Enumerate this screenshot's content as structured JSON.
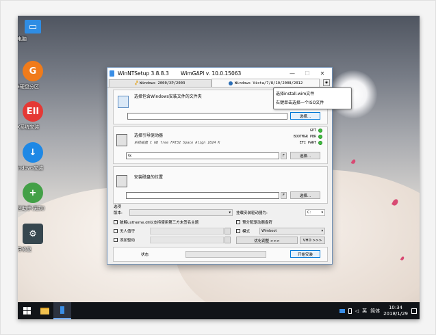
{
  "desktop": {
    "icons": [
      {
        "label": "此电脑",
        "icon": "computer-icon",
        "color": "#2f8de4"
      },
      {
        "label": "DG硬盘分区",
        "icon": "dg-icon",
        "color": "#f07b1a"
      },
      {
        "label": "EIX系统安装",
        "icon": "eix-icon",
        "color": "#e53935"
      },
      {
        "label": "Windows安装",
        "icon": "download-icon",
        "color": "#1e88e5"
      },
      {
        "label": "分区助手(无损)",
        "icon": "partition-icon",
        "color": "#43a047"
      },
      {
        "label": "引导修复",
        "icon": "gear-icon",
        "color": "#37474f"
      }
    ]
  },
  "window": {
    "title": "WinNTSetup 3.8.8.3",
    "title_api": "WimGAPI v. 10.0.15063",
    "tabs": [
      {
        "label": "Windows 2000/XP/2003"
      },
      {
        "label": "Windows Vista/7/8/10/2008/2012"
      }
    ],
    "source": {
      "title": "选择包含Windows安装文件的文件夹",
      "value": "",
      "button": "选择..."
    },
    "boot": {
      "title": "选择引导驱动器",
      "subtitle": "系统磁盘 C GB free FAT32 Space Align 1024 K",
      "value": "G:",
      "f_button": "F",
      "button": "选择...",
      "leds": [
        "GPT",
        "BOOTMGR PBR",
        "EFI PART"
      ]
    },
    "install": {
      "title": "安装磁盘的位置",
      "value": "",
      "f_button": "F",
      "button": "选择..."
    },
    "options": {
      "label_options": "选项",
      "label_version": "版本:",
      "version_value": "",
      "mount_label": "挂载安装驱动器为:",
      "mount_value": "C:",
      "uxtheme": "破解uxtheme.dll以支持使用第三方未签名主题",
      "unattended": "无人值守",
      "add_drivers": "添加驱动",
      "prealloc": "预分配驱动器盘符",
      "mode_label": "模式",
      "mode_value": "Wimboot",
      "tweaks_button": "优化调整 >>>",
      "vhd_button": "VHD >>>"
    },
    "status_label": "状态",
    "install_button": "开始安装"
  },
  "tooltip": {
    "line1": "选择install.wim文件",
    "line2": "右键单击选择一个ISO文件"
  },
  "taskbar": {
    "ime_label": "英",
    "ime_mode": "简体",
    "time": "10:34",
    "date": "2018/1/29"
  }
}
